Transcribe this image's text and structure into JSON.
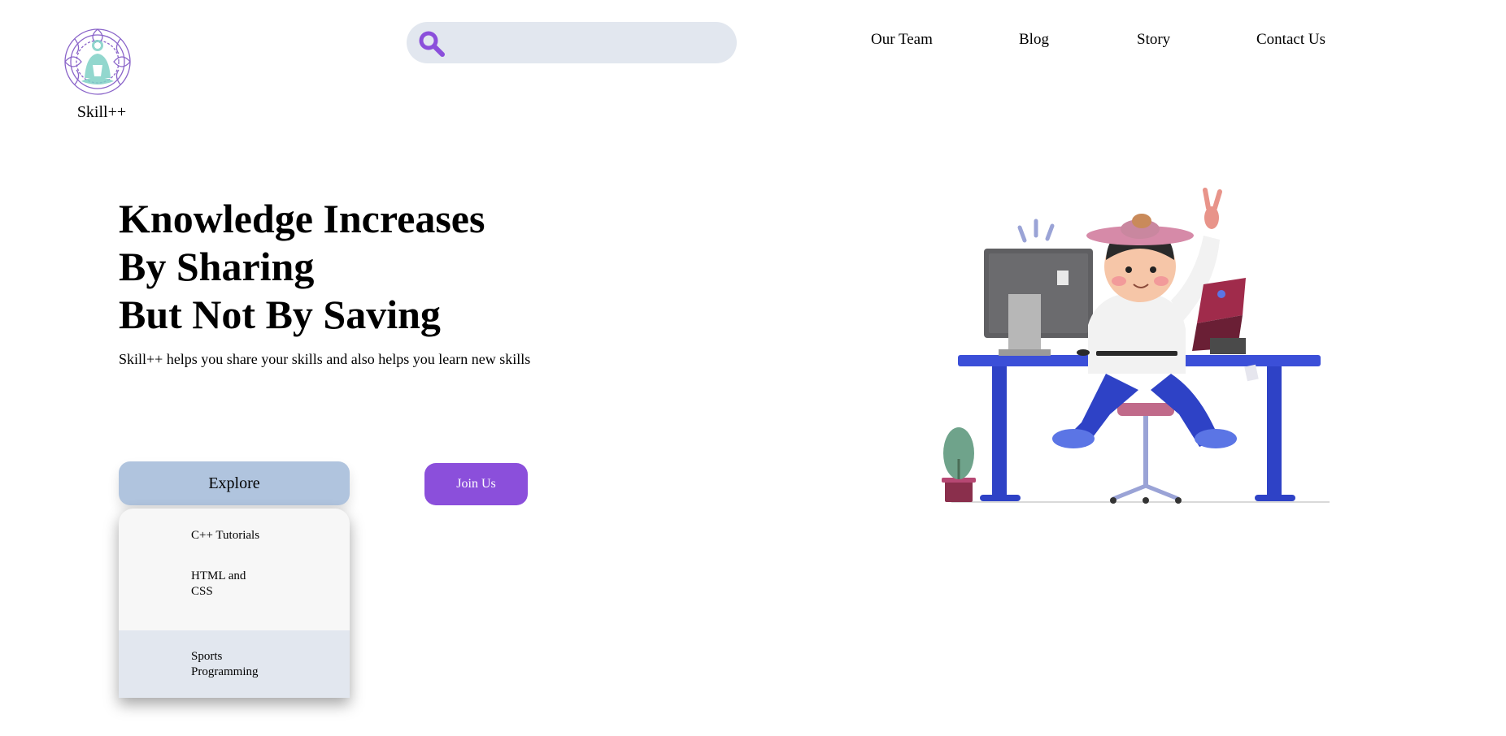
{
  "brand": {
    "name": "Skill++"
  },
  "search": {
    "placeholder": ""
  },
  "nav": {
    "items": [
      {
        "label": "Our Team"
      },
      {
        "label": "Blog"
      },
      {
        "label": "Story"
      },
      {
        "label": "Contact Us"
      }
    ]
  },
  "hero": {
    "headline": [
      "Knowledge Increases",
      "By Sharing",
      "But Not By Saving"
    ],
    "tagline": "Skill++ helps you share your skills and also helps you learn new skills"
  },
  "buttons": {
    "explore_label": "Explore",
    "join_label": "Join Us"
  },
  "dropdown": {
    "items": [
      {
        "label": "C++ Tutorials"
      },
      {
        "label": "HTML and CSS"
      },
      {
        "label": "Sports Programming"
      }
    ]
  },
  "icons": {
    "search": "search-icon",
    "logo": "mandala-meditation-logo",
    "illustration": "person-at-desk-illustration"
  },
  "colors": {
    "accent": "#8b4fdb",
    "search_bg": "#e2e7ef",
    "explore_bg": "#b0c4de",
    "desk_blue": "#3b4fd8",
    "dropdown_hover": "#e2e7ef"
  }
}
